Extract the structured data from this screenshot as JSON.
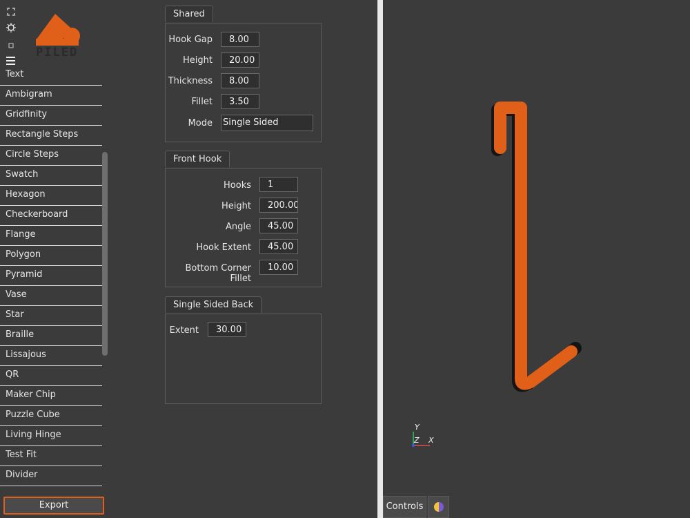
{
  "app": {
    "logo_text": "PILED",
    "accent_color": "#e0601a"
  },
  "toolbar_icons": [
    "fullscreen-icon",
    "settings-icon",
    "square-icon",
    "menu-icon"
  ],
  "sidebar": {
    "items": [
      "Text",
      "Ambigram",
      "Gridfinity",
      "Rectangle Steps",
      "Circle Steps",
      "Swatch",
      "Hexagon",
      "Checkerboard",
      "Flange",
      "Polygon",
      "Pyramid",
      "Vase",
      "Star",
      "Braille",
      "Lissajous",
      "QR",
      "Maker Chip",
      "Puzzle Cube",
      "Living Hinge",
      "Test Fit",
      "Divider"
    ],
    "export_label": "Export"
  },
  "shared": {
    "title": "Shared",
    "hook_gap_label": "Hook Gap",
    "hook_gap": "8.00",
    "height_label": "Height",
    "height": "20.00",
    "thickness_label": "Thickness",
    "thickness": "8.00",
    "fillet_label": "Fillet",
    "fillet": "3.50",
    "mode_label": "Mode",
    "mode": "Single Sided"
  },
  "front_hook": {
    "title": "Front Hook",
    "hooks_label": "Hooks",
    "hooks": "1",
    "height_label": "Height",
    "height": "200.00",
    "angle_label": "Angle",
    "angle": "45.00",
    "hook_extent_label": "Hook Extent",
    "hook_extent": "45.00",
    "bottom_corner_fillet_label": "Bottom Corner Fillet",
    "bottom_corner_fillet": "10.00"
  },
  "single_sided_back": {
    "title": "Single Sided Back",
    "extent_label": "Extent",
    "extent": "30.00"
  },
  "viewport": {
    "axis_y": "Y",
    "axis_z": "Z",
    "axis_x": "X",
    "controls_tab": "Controls",
    "model_color": "#e0601a"
  }
}
